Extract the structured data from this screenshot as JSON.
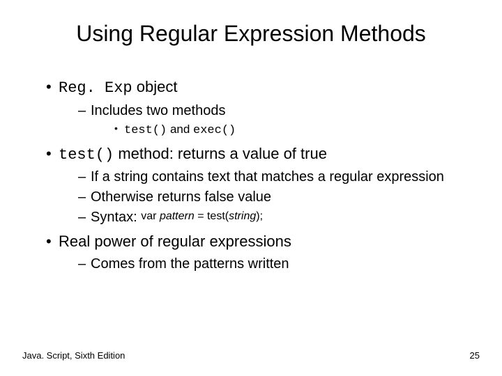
{
  "title": "Using Regular Expression Methods",
  "bullets": {
    "regexp_obj_pre": "Reg. Exp",
    "regexp_obj_post": " object",
    "two_methods": "Includes two methods",
    "test_exec_pre": "test()",
    "test_exec_mid": " and ",
    "test_exec_post": "exec()",
    "test_method_pre": "test()",
    "test_method_post": " method: returns a value of true",
    "if_string": "If a string contains text that matches a regular expression",
    "otherwise": "Otherwise returns false value",
    "syntax_label": "Syntax: ",
    "syntax_var": "var ",
    "syntax_pattern": "pattern",
    "syntax_eq": " = test(",
    "syntax_string": "string",
    "syntax_end": ");",
    "real_power": "Real power of regular expressions",
    "comes_from": "Comes from the patterns written"
  },
  "footer": {
    "left": "Java. Script, Sixth Edition",
    "page": "25"
  }
}
